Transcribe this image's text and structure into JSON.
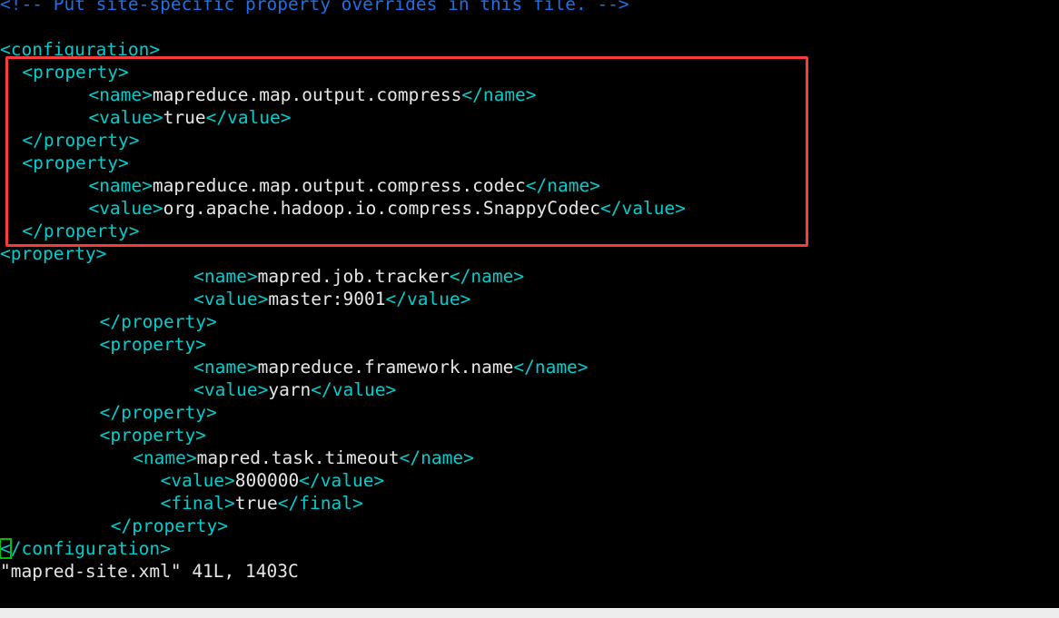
{
  "window": {
    "title": "mapred-site.xml",
    "editor": "vim"
  },
  "theme": {
    "background": "#000000",
    "tag_color": "#00cdcd",
    "text_color": "#e6e6e6",
    "comment_color": "#1f6fe8",
    "highlight_border": "#f93a3a",
    "cursor_border": "#00c000",
    "bottom_bar": "#ededed"
  },
  "code_lines": [
    {
      "id": "line-comment",
      "indent": 0,
      "segments": [
        {
          "kind": "comment",
          "text": "<!-- Put site-specific property overrides in this file. -->"
        }
      ]
    },
    {
      "id": "line-blank-1",
      "indent": 0,
      "segments": [
        {
          "kind": "text",
          "text": ""
        }
      ]
    },
    {
      "id": "line-configuration-open",
      "indent": 0,
      "segments": [
        {
          "kind": "tag",
          "text": "<configuration>"
        }
      ]
    },
    {
      "id": "line-property-open-1",
      "indent": 2,
      "segments": [
        {
          "kind": "tag",
          "text": "<property>"
        }
      ]
    },
    {
      "id": "line-name-1",
      "indent": 8,
      "segments": [
        {
          "kind": "tag",
          "text": "<name>"
        },
        {
          "kind": "text",
          "text": "mapreduce.map.output.compress"
        },
        {
          "kind": "tag",
          "text": "</name>"
        }
      ]
    },
    {
      "id": "line-value-1",
      "indent": 8,
      "segments": [
        {
          "kind": "tag",
          "text": "<value>"
        },
        {
          "kind": "text",
          "text": "true"
        },
        {
          "kind": "tag",
          "text": "</value>"
        }
      ]
    },
    {
      "id": "line-property-close-1",
      "indent": 2,
      "segments": [
        {
          "kind": "tag",
          "text": "</property>"
        }
      ]
    },
    {
      "id": "line-property-open-2",
      "indent": 2,
      "segments": [
        {
          "kind": "tag",
          "text": "<property>"
        }
      ]
    },
    {
      "id": "line-name-2",
      "indent": 8,
      "segments": [
        {
          "kind": "tag",
          "text": "<name>"
        },
        {
          "kind": "text",
          "text": "mapreduce.map.output.compress.codec"
        },
        {
          "kind": "tag",
          "text": "</name>"
        }
      ]
    },
    {
      "id": "line-value-2",
      "indent": 8,
      "segments": [
        {
          "kind": "tag",
          "text": "<value>"
        },
        {
          "kind": "text",
          "text": "org.apache.hadoop.io.compress.SnappyCodec"
        },
        {
          "kind": "tag",
          "text": "</value>"
        }
      ]
    },
    {
      "id": "line-property-close-2",
      "indent": 2,
      "segments": [
        {
          "kind": "tag",
          "text": "</property>"
        }
      ]
    },
    {
      "id": "line-property-open-3",
      "indent": 0,
      "segments": [
        {
          "kind": "tag",
          "text": "<property>"
        }
      ]
    },
    {
      "id": "line-name-3",
      "indent": 17.5,
      "segments": [
        {
          "kind": "tag",
          "text": "<name>"
        },
        {
          "kind": "text",
          "text": "mapred.job.tracker"
        },
        {
          "kind": "tag",
          "text": "</name>"
        }
      ]
    },
    {
      "id": "line-value-3",
      "indent": 17.5,
      "segments": [
        {
          "kind": "tag",
          "text": "<value>"
        },
        {
          "kind": "text",
          "text": "master:9001"
        },
        {
          "kind": "tag",
          "text": "</value>"
        }
      ]
    },
    {
      "id": "line-property-close-3",
      "indent": 9,
      "segments": [
        {
          "kind": "tag",
          "text": "</property>"
        }
      ]
    },
    {
      "id": "line-property-open-4",
      "indent": 9,
      "segments": [
        {
          "kind": "tag",
          "text": "<property>"
        }
      ]
    },
    {
      "id": "line-name-4",
      "indent": 17.5,
      "segments": [
        {
          "kind": "tag",
          "text": "<name>"
        },
        {
          "kind": "text",
          "text": "mapreduce.framework.name"
        },
        {
          "kind": "tag",
          "text": "</name>"
        }
      ]
    },
    {
      "id": "line-value-4",
      "indent": 17.5,
      "segments": [
        {
          "kind": "tag",
          "text": "<value>"
        },
        {
          "kind": "text",
          "text": "yarn"
        },
        {
          "kind": "tag",
          "text": "</value>"
        }
      ]
    },
    {
      "id": "line-property-close-4",
      "indent": 9,
      "segments": [
        {
          "kind": "tag",
          "text": "</property>"
        }
      ]
    },
    {
      "id": "line-property-open-5",
      "indent": 9,
      "segments": [
        {
          "kind": "tag",
          "text": "<property>"
        }
      ]
    },
    {
      "id": "line-name-5",
      "indent": 12,
      "segments": [
        {
          "kind": "tag",
          "text": "<name>"
        },
        {
          "kind": "text",
          "text": "mapred.task.timeout"
        },
        {
          "kind": "tag",
          "text": "</name>"
        }
      ]
    },
    {
      "id": "line-value-5",
      "indent": 14.5,
      "segments": [
        {
          "kind": "tag",
          "text": "<value>"
        },
        {
          "kind": "text",
          "text": "800000"
        },
        {
          "kind": "tag",
          "text": "</value>"
        }
      ]
    },
    {
      "id": "line-final-5",
      "indent": 14.5,
      "segments": [
        {
          "kind": "tag",
          "text": "<final>"
        },
        {
          "kind": "text",
          "text": "true"
        },
        {
          "kind": "tag",
          "text": "</final>"
        }
      ]
    },
    {
      "id": "line-property-close-5",
      "indent": 10,
      "segments": [
        {
          "kind": "tag",
          "text": "</property>"
        }
      ]
    },
    {
      "id": "line-configuration-close",
      "indent": 0,
      "segments": [
        {
          "kind": "cursor",
          "text": "<"
        },
        {
          "kind": "tag",
          "text": "/configuration>"
        }
      ]
    }
  ],
  "status_line": {
    "filename_quoted": "\"mapred-site.xml\"",
    "lines": "41L,",
    "chars": "1403C",
    "full": "\"mapred-site.xml\" 41L, 1403C"
  },
  "highlight": {
    "label": "annotation-rectangle",
    "color": "#f93a3a",
    "covers_lines": [
      "<property>",
      "<name>mapreduce.map.output.compress</name>",
      "<value>true</value>",
      "</property>",
      "<property>",
      "<name>mapreduce.map.output.compress.codec</name>",
      "<value>org.apache.hadoop.io.compress.SnappyCodec</value>",
      "</property>"
    ]
  }
}
